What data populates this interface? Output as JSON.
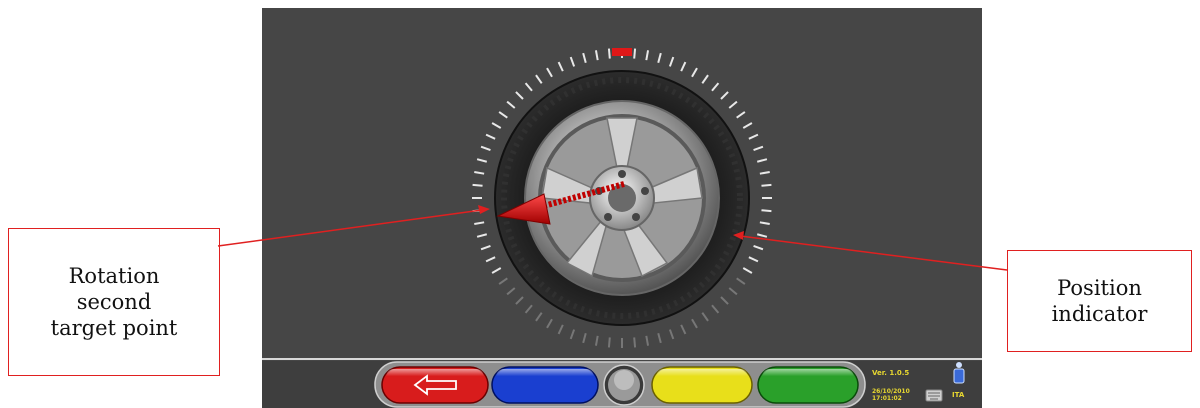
{
  "callouts": {
    "left": "Rotation\nsecond\ntarget point",
    "right": "Position\nindicator"
  },
  "status": {
    "version": "Ver. 1.0.5",
    "date": "26/10/2010",
    "time": "17:01:02",
    "language": "ITA"
  },
  "toolbar": {
    "buttons": [
      {
        "name": "back-button",
        "color": "#d81c1c",
        "icon": "back-arrow-icon"
      },
      {
        "name": "blue-button",
        "color": "#1a3fd0"
      },
      {
        "name": "center-button",
        "color": "#8a8a8a"
      },
      {
        "name": "yellow-button",
        "color": "#e8df1a"
      },
      {
        "name": "green-button",
        "color": "#2aa02a"
      }
    ]
  },
  "colors": {
    "screen_bg": "#464646",
    "indicator_active": "#e01818",
    "tick_light": "#e8e8e8",
    "tick_dark": "#777777",
    "callout_border": "#e02020"
  }
}
